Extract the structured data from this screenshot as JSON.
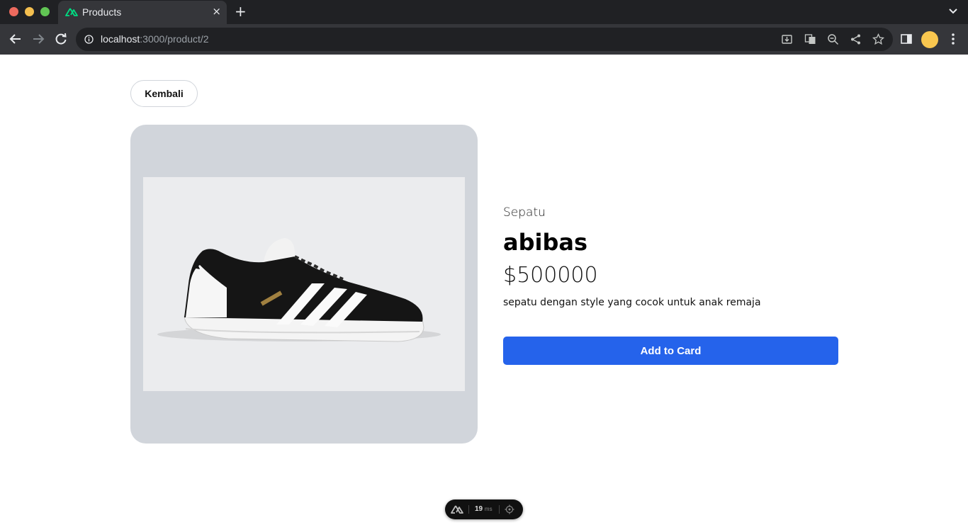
{
  "browser": {
    "tab": {
      "title": "Products",
      "close_glyph": "×",
      "favicon": "nuxt-icon"
    },
    "new_tab_glyph": "+",
    "url": {
      "host": "localhost",
      "path": ":3000/product/2"
    }
  },
  "page": {
    "back_label": "Kembali",
    "product": {
      "category": "Sepatu",
      "name": "abibas",
      "price": "$500000",
      "description": "sepatu dengan style yang cocok untuk anak remaja",
      "image": "sneaker-image"
    },
    "add_label": "Add to Card"
  },
  "devtools": {
    "value": "19",
    "unit": "ms"
  },
  "colors": {
    "accent": "#2563eb",
    "image_card": "#d1d5db",
    "nuxt_green": "#00dc82"
  }
}
